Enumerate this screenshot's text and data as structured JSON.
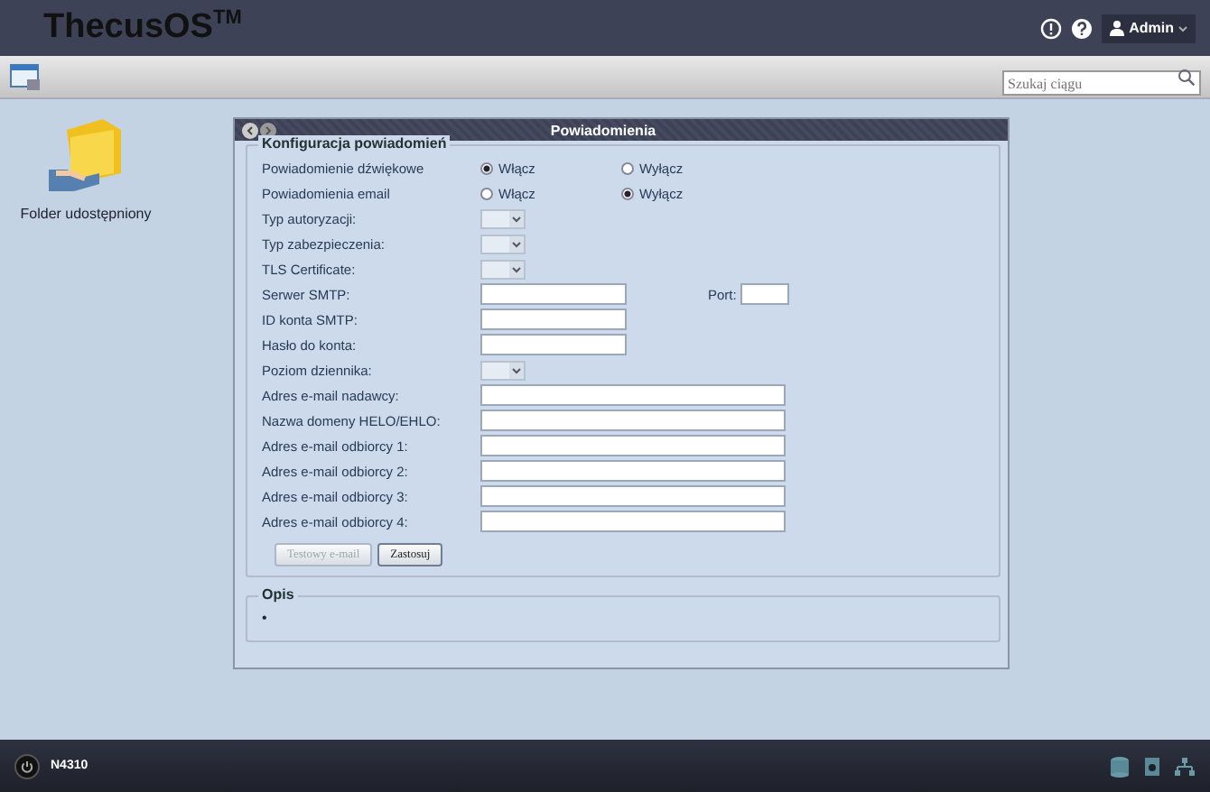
{
  "header": {
    "logo": "ThecusOS",
    "logo_mark": "TM",
    "user": "Admin"
  },
  "toolbar": {
    "search": {
      "placeholder": "Szukaj ciągu"
    }
  },
  "desktop": {
    "icons": [
      {
        "label": "Folder udostępniony"
      }
    ]
  },
  "dialog": {
    "title": "Powiadomienia",
    "section": "Konfiguracja powiadomień",
    "rows": [
      {
        "kind": "radio",
        "label": "Powiadomienie dźwiękowe",
        "options": [
          {
            "label": "Włącz",
            "selected": true
          },
          {
            "label": "Wyłącz",
            "selected": false
          }
        ]
      },
      {
        "kind": "radio",
        "label": "Powiadomienia email",
        "options": [
          {
            "label": "Włącz",
            "selected": false
          },
          {
            "label": "Wyłącz",
            "selected": true
          }
        ]
      },
      {
        "kind": "select",
        "label": "Typ autoryzacji:"
      },
      {
        "kind": "select",
        "label": "Typ zabezpieczenia:"
      },
      {
        "kind": "select",
        "label": "TLS Certificate:"
      },
      {
        "kind": "text_port",
        "label": "Serwer SMTP:",
        "port_label": "Port:"
      },
      {
        "kind": "text",
        "label": "ID konta SMTP:"
      },
      {
        "kind": "text",
        "label": "Hasło do konta:"
      },
      {
        "kind": "select",
        "label": "Poziom dziennika:"
      },
      {
        "kind": "wide",
        "label": "Adres e-mail nadawcy:"
      },
      {
        "kind": "wide",
        "label": "Nazwa domeny HELO/EHLO:"
      },
      {
        "kind": "wide",
        "label": "Adres e-mail odbiorcy 1:"
      },
      {
        "kind": "wide",
        "label": "Adres e-mail odbiorcy 2:"
      },
      {
        "kind": "wide",
        "label": "Adres e-mail odbiorcy 3:"
      },
      {
        "kind": "wide",
        "label": "Adres e-mail odbiorcy 4:"
      }
    ],
    "buttons": [
      {
        "label": "Testowy e-mail",
        "disabled": true
      },
      {
        "label": "Zastosuj",
        "disabled": false
      }
    ],
    "description": {
      "title": "Opis",
      "bullet": "•"
    }
  },
  "taskbar": {
    "device": "N4310"
  }
}
